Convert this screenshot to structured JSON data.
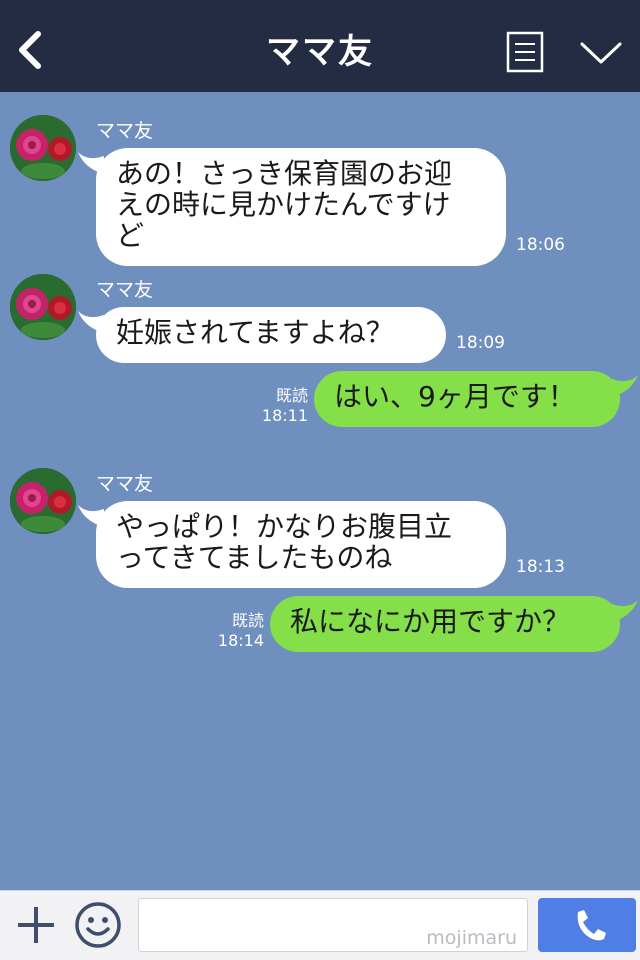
{
  "header": {
    "title": "ママ友",
    "back_icon": "chevron-left-icon",
    "menu_icon": "menu-list-icon",
    "more_icon": "chevron-down-icon"
  },
  "messages": [
    {
      "from": "ママ友",
      "lines": [
        "あの！さっき保育園のお迎",
        "えの時に見かけたんですけ",
        "ど"
      ],
      "time": "18:06"
    },
    {
      "from": "ママ友",
      "lines": [
        "妊娠されてますよね？"
      ],
      "time": "18:09"
    },
    {
      "read": "既読",
      "text": "はい、9ヶ月です！",
      "time": "18:11"
    },
    {
      "from": "ママ友",
      "lines": [
        "やっぱり！かなりお腹目立",
        "ってきてましたものね"
      ],
      "time": "18:13"
    },
    {
      "read": "既読",
      "text": "私になにか用ですか？",
      "time": "18:14"
    }
  ],
  "footer": {
    "add_icon": "plus-icon",
    "sticker_icon": "smiley-icon",
    "input_value": "",
    "watermark": "mojimaru",
    "call_icon": "phone-icon"
  },
  "colors": {
    "header_bg": "#232c42",
    "chat_bg": "#6f8fbe",
    "outgoing_bubble": "#84df48",
    "incoming_bubble": "#ffffff",
    "call_button": "#4f7fe6"
  }
}
